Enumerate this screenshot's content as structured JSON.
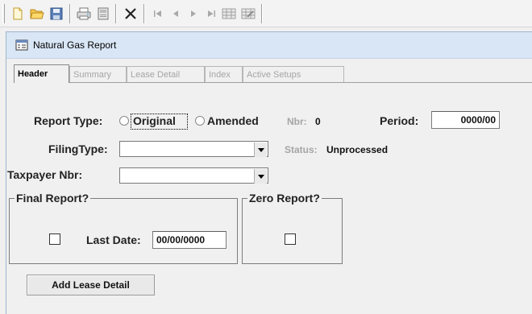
{
  "toolbar": {
    "buttons": [
      {
        "name": "new-icon"
      },
      {
        "name": "open-folder-icon"
      },
      {
        "name": "save-icon"
      },
      {
        "name": "print-icon"
      },
      {
        "name": "preview-icon"
      },
      {
        "name": "delete-icon",
        "glyph": "✕"
      },
      {
        "name": "first-record-icon",
        "glyph": "|◀"
      },
      {
        "name": "previous-record-icon",
        "glyph": "◀"
      },
      {
        "name": "next-record-icon",
        "glyph": "▶"
      },
      {
        "name": "last-record-icon",
        "glyph": "▶|"
      },
      {
        "name": "grid-icon"
      },
      {
        "name": "grid-edit-icon"
      }
    ]
  },
  "window": {
    "title": "Natural Gas Report"
  },
  "tabs": [
    {
      "label": "Header",
      "active": true
    },
    {
      "label": "Summary",
      "active": false
    },
    {
      "label": "Lease Detail",
      "active": false
    },
    {
      "label": "Index",
      "active": false
    },
    {
      "label": "Active Setups",
      "active": false
    }
  ],
  "form": {
    "report_type_label": "Report Type:",
    "option_original": "Original",
    "option_amended": "Amended",
    "nbr_label": "Nbr:",
    "nbr_value": "0",
    "period_label": "Period:",
    "period_value": "0000/00",
    "filing_type_label": "FilingType:",
    "filing_type_value": "",
    "status_label": "Status:",
    "status_value": "Unprocessed",
    "taxpayer_label": "Taxpayer Nbr:",
    "taxpayer_value": "",
    "final_report_title": "Final Report?",
    "last_date_label": "Last Date:",
    "last_date_value": "00/00/0000",
    "zero_report_title": "Zero Report?",
    "add_lease_button": "Add Lease Detail"
  },
  "colors": {
    "titlebar": "#d9e6f5",
    "disabled_text": "#a5a5a5",
    "background": "#f0f0f0"
  }
}
